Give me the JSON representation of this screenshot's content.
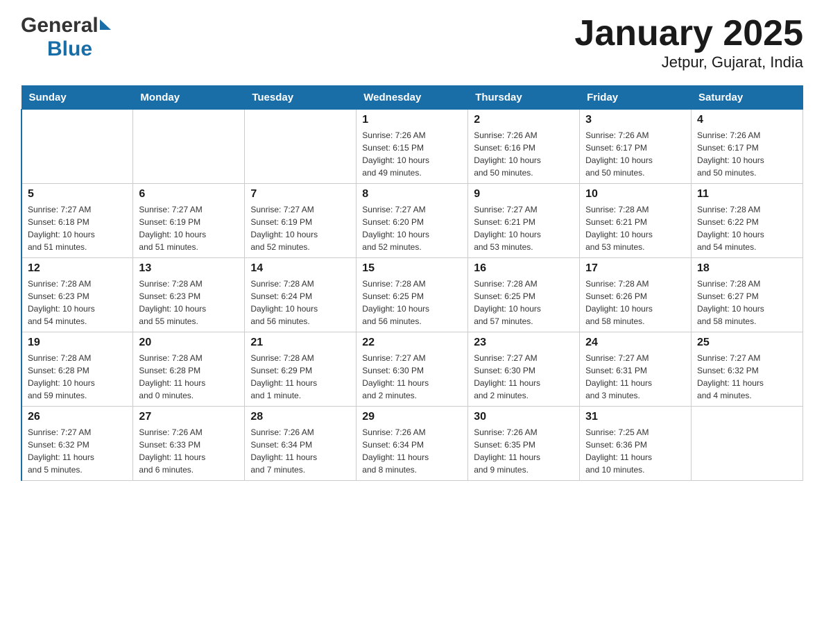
{
  "header": {
    "title": "January 2025",
    "subtitle": "Jetpur, Gujarat, India",
    "logo_general": "General",
    "logo_blue": "Blue"
  },
  "days_of_week": [
    "Sunday",
    "Monday",
    "Tuesday",
    "Wednesday",
    "Thursday",
    "Friday",
    "Saturday"
  ],
  "weeks": [
    {
      "days": [
        {
          "number": "",
          "info": ""
        },
        {
          "number": "",
          "info": ""
        },
        {
          "number": "",
          "info": ""
        },
        {
          "number": "1",
          "info": "Sunrise: 7:26 AM\nSunset: 6:15 PM\nDaylight: 10 hours\nand 49 minutes."
        },
        {
          "number": "2",
          "info": "Sunrise: 7:26 AM\nSunset: 6:16 PM\nDaylight: 10 hours\nand 50 minutes."
        },
        {
          "number": "3",
          "info": "Sunrise: 7:26 AM\nSunset: 6:17 PM\nDaylight: 10 hours\nand 50 minutes."
        },
        {
          "number": "4",
          "info": "Sunrise: 7:26 AM\nSunset: 6:17 PM\nDaylight: 10 hours\nand 50 minutes."
        }
      ]
    },
    {
      "days": [
        {
          "number": "5",
          "info": "Sunrise: 7:27 AM\nSunset: 6:18 PM\nDaylight: 10 hours\nand 51 minutes."
        },
        {
          "number": "6",
          "info": "Sunrise: 7:27 AM\nSunset: 6:19 PM\nDaylight: 10 hours\nand 51 minutes."
        },
        {
          "number": "7",
          "info": "Sunrise: 7:27 AM\nSunset: 6:19 PM\nDaylight: 10 hours\nand 52 minutes."
        },
        {
          "number": "8",
          "info": "Sunrise: 7:27 AM\nSunset: 6:20 PM\nDaylight: 10 hours\nand 52 minutes."
        },
        {
          "number": "9",
          "info": "Sunrise: 7:27 AM\nSunset: 6:21 PM\nDaylight: 10 hours\nand 53 minutes."
        },
        {
          "number": "10",
          "info": "Sunrise: 7:28 AM\nSunset: 6:21 PM\nDaylight: 10 hours\nand 53 minutes."
        },
        {
          "number": "11",
          "info": "Sunrise: 7:28 AM\nSunset: 6:22 PM\nDaylight: 10 hours\nand 54 minutes."
        }
      ]
    },
    {
      "days": [
        {
          "number": "12",
          "info": "Sunrise: 7:28 AM\nSunset: 6:23 PM\nDaylight: 10 hours\nand 54 minutes."
        },
        {
          "number": "13",
          "info": "Sunrise: 7:28 AM\nSunset: 6:23 PM\nDaylight: 10 hours\nand 55 minutes."
        },
        {
          "number": "14",
          "info": "Sunrise: 7:28 AM\nSunset: 6:24 PM\nDaylight: 10 hours\nand 56 minutes."
        },
        {
          "number": "15",
          "info": "Sunrise: 7:28 AM\nSunset: 6:25 PM\nDaylight: 10 hours\nand 56 minutes."
        },
        {
          "number": "16",
          "info": "Sunrise: 7:28 AM\nSunset: 6:25 PM\nDaylight: 10 hours\nand 57 minutes."
        },
        {
          "number": "17",
          "info": "Sunrise: 7:28 AM\nSunset: 6:26 PM\nDaylight: 10 hours\nand 58 minutes."
        },
        {
          "number": "18",
          "info": "Sunrise: 7:28 AM\nSunset: 6:27 PM\nDaylight: 10 hours\nand 58 minutes."
        }
      ]
    },
    {
      "days": [
        {
          "number": "19",
          "info": "Sunrise: 7:28 AM\nSunset: 6:28 PM\nDaylight: 10 hours\nand 59 minutes."
        },
        {
          "number": "20",
          "info": "Sunrise: 7:28 AM\nSunset: 6:28 PM\nDaylight: 11 hours\nand 0 minutes."
        },
        {
          "number": "21",
          "info": "Sunrise: 7:28 AM\nSunset: 6:29 PM\nDaylight: 11 hours\nand 1 minute."
        },
        {
          "number": "22",
          "info": "Sunrise: 7:27 AM\nSunset: 6:30 PM\nDaylight: 11 hours\nand 2 minutes."
        },
        {
          "number": "23",
          "info": "Sunrise: 7:27 AM\nSunset: 6:30 PM\nDaylight: 11 hours\nand 2 minutes."
        },
        {
          "number": "24",
          "info": "Sunrise: 7:27 AM\nSunset: 6:31 PM\nDaylight: 11 hours\nand 3 minutes."
        },
        {
          "number": "25",
          "info": "Sunrise: 7:27 AM\nSunset: 6:32 PM\nDaylight: 11 hours\nand 4 minutes."
        }
      ]
    },
    {
      "days": [
        {
          "number": "26",
          "info": "Sunrise: 7:27 AM\nSunset: 6:32 PM\nDaylight: 11 hours\nand 5 minutes."
        },
        {
          "number": "27",
          "info": "Sunrise: 7:26 AM\nSunset: 6:33 PM\nDaylight: 11 hours\nand 6 minutes."
        },
        {
          "number": "28",
          "info": "Sunrise: 7:26 AM\nSunset: 6:34 PM\nDaylight: 11 hours\nand 7 minutes."
        },
        {
          "number": "29",
          "info": "Sunrise: 7:26 AM\nSunset: 6:34 PM\nDaylight: 11 hours\nand 8 minutes."
        },
        {
          "number": "30",
          "info": "Sunrise: 7:26 AM\nSunset: 6:35 PM\nDaylight: 11 hours\nand 9 minutes."
        },
        {
          "number": "31",
          "info": "Sunrise: 7:25 AM\nSunset: 6:36 PM\nDaylight: 11 hours\nand 10 minutes."
        },
        {
          "number": "",
          "info": ""
        }
      ]
    }
  ]
}
